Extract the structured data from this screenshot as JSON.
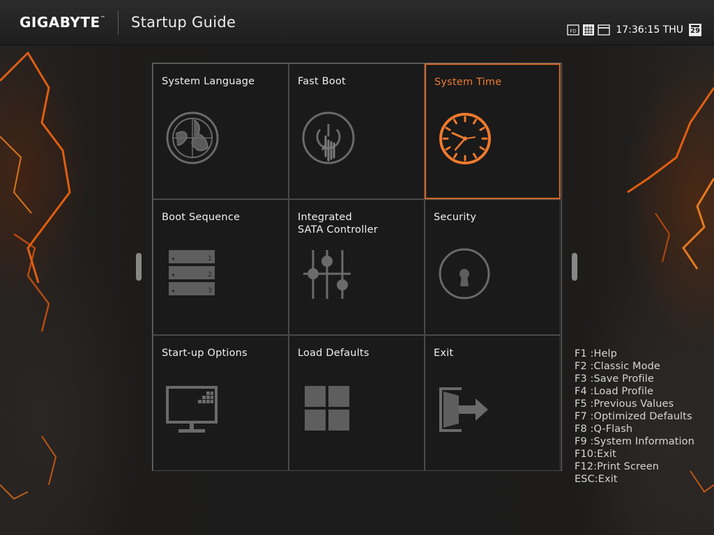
{
  "header": {
    "brand": "GIGABYTE",
    "brand_tm": "™",
    "title": "Startup Guide",
    "status_icons": [
      "fd-icon",
      "grid-view-icon",
      "window-icon"
    ],
    "time": "17:36:15 THU",
    "calendar_day": "29"
  },
  "accent_color": "#f07a2d",
  "tiles": [
    {
      "label": "System Language",
      "icon": "globe-icon"
    },
    {
      "label": "Fast Boot",
      "icon": "power-touch-icon"
    },
    {
      "label": "System Time",
      "icon": "clock-icon",
      "active": true
    },
    {
      "label": "Boot Sequence",
      "icon": "boot-list-icon"
    },
    {
      "label": "Integrated\nSATA Controller",
      "icon": "sliders-icon"
    },
    {
      "label": "Security",
      "icon": "keyhole-icon"
    },
    {
      "label": "Start-up Options",
      "icon": "monitor-icon"
    },
    {
      "label": "Load Defaults",
      "icon": "four-squares-icon"
    },
    {
      "label": "Exit",
      "icon": "exit-icon"
    }
  ],
  "boot_list_numbers": [
    "1",
    "2",
    "3"
  ],
  "hotkeys": [
    "F1 :Help",
    "F2 :Classic Mode",
    "F3 :Save Profile",
    "F4 :Load Profile",
    "F5 :Previous Values",
    "F7 :Optimized Defaults",
    "F8 :Q-Flash",
    "F9 :System Information",
    "F10:Exit",
    "F12:Print Screen",
    "ESC:Exit"
  ]
}
